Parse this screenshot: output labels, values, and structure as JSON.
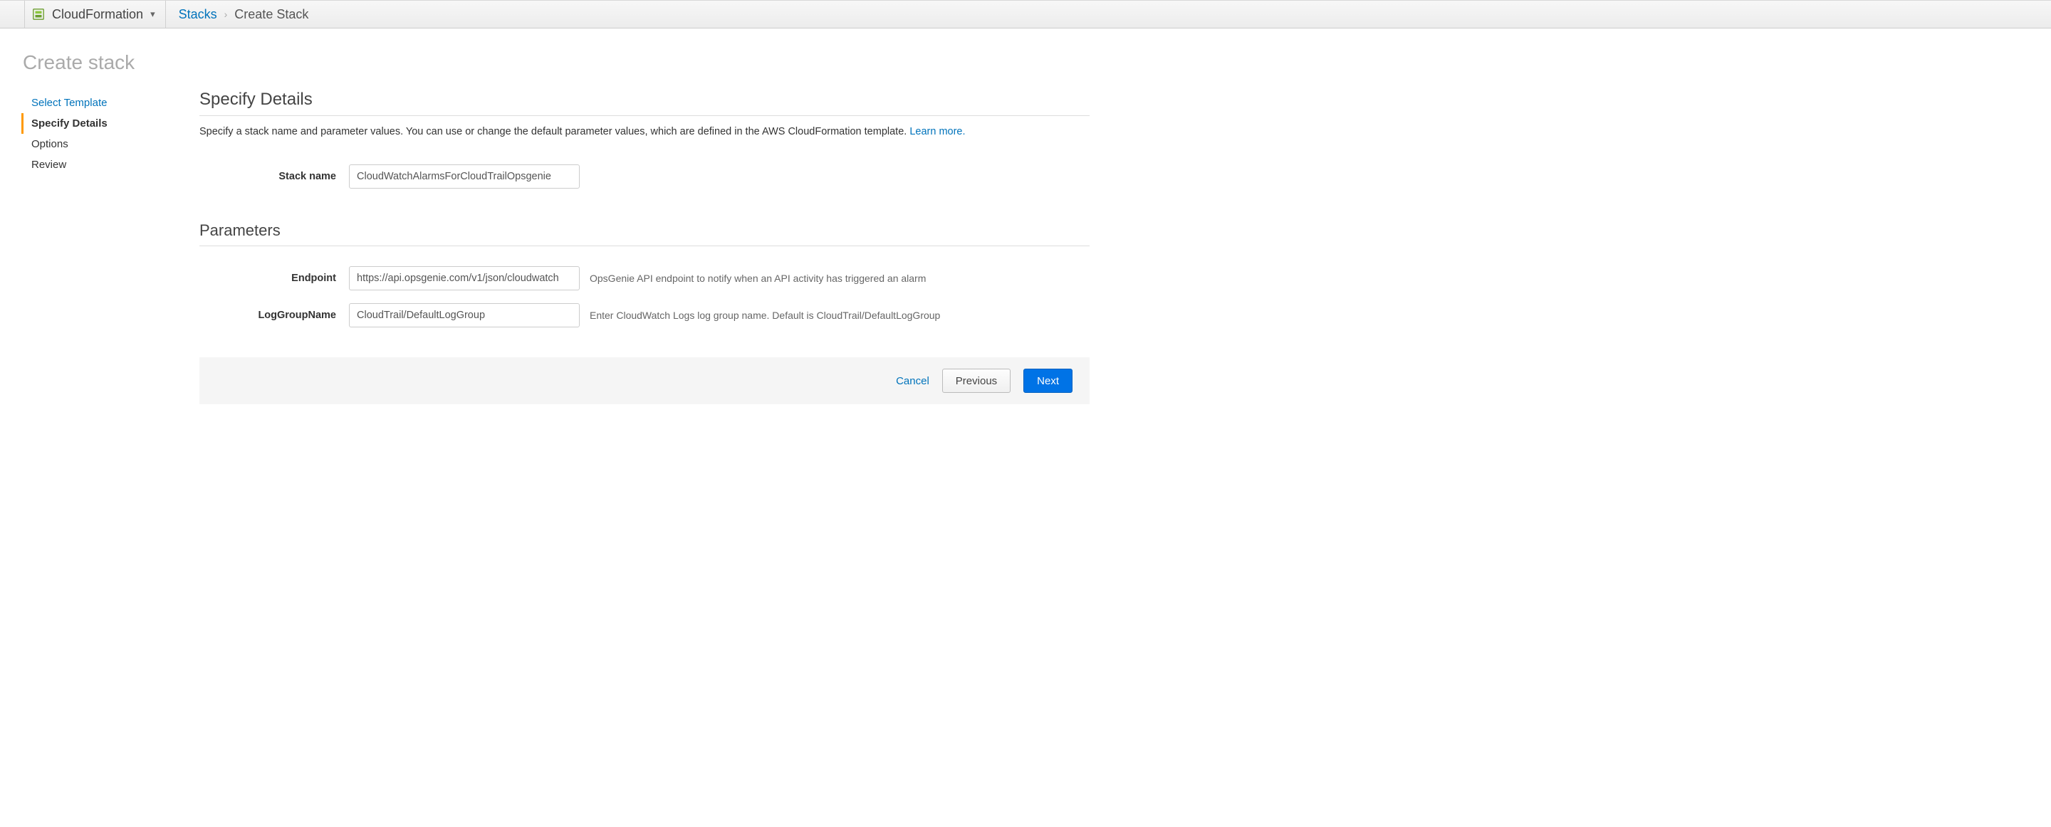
{
  "topbar": {
    "service_name": "CloudFormation",
    "crumb_link": "Stacks",
    "crumb_current": "Create Stack"
  },
  "page_title": "Create stack",
  "wizard_steps": {
    "step0": "Select Template",
    "step1": "Specify Details",
    "step2": "Options",
    "step3": "Review"
  },
  "details": {
    "heading": "Specify Details",
    "desc_text": "Specify a stack name and parameter values. You can use or change the default parameter values, which are defined in the AWS CloudFormation template. ",
    "learn_more": "Learn more."
  },
  "form": {
    "stack_name_label": "Stack name",
    "stack_name_value": "CloudWatchAlarmsForCloudTrailOpsgenie"
  },
  "parameters": {
    "heading": "Parameters",
    "endpoint_label": "Endpoint",
    "endpoint_value": "https://api.opsgenie.com/v1/json/cloudwatch",
    "endpoint_help": "OpsGenie API endpoint to notify when an API activity has triggered an alarm",
    "loggroup_label": "LogGroupName",
    "loggroup_value": "CloudTrail/DefaultLogGroup",
    "loggroup_help": "Enter CloudWatch Logs log group name. Default is CloudTrail/DefaultLogGroup"
  },
  "buttons": {
    "cancel": "Cancel",
    "previous": "Previous",
    "next": "Next"
  }
}
